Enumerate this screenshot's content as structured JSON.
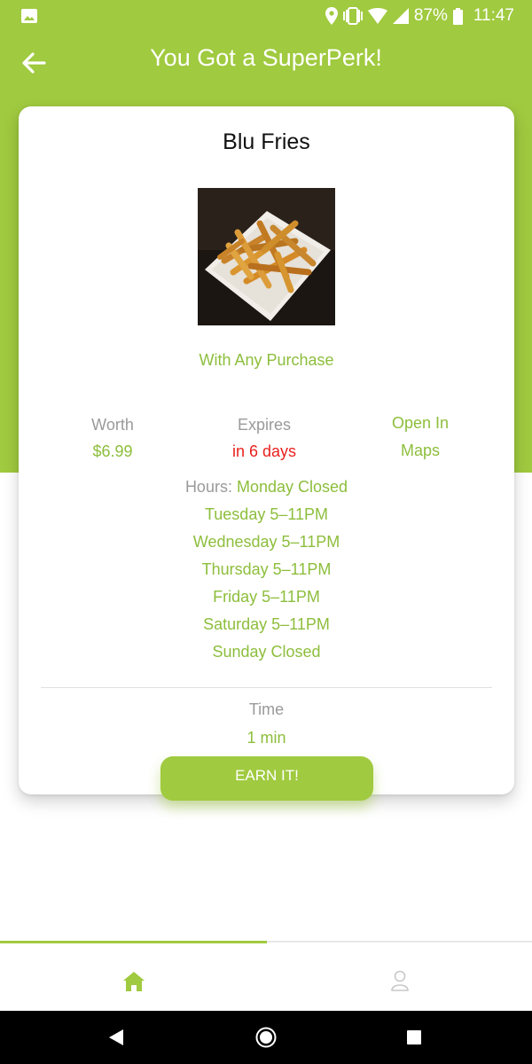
{
  "status_bar": {
    "battery": "87%",
    "time": "11:47",
    "icons": [
      "image-icon",
      "location-icon",
      "vibrate-icon",
      "wifi-icon",
      "signal-icon",
      "battery-icon"
    ]
  },
  "header": {
    "title": "You Got a SuperPerk!",
    "back_icon": "arrow-left-icon"
  },
  "perk": {
    "name": "Blu Fries",
    "image": "fries-photo",
    "condition": "With Any Purchase",
    "worth_label": "Worth",
    "worth_value": "$6.99",
    "expires_label": "Expires",
    "expires_value": "in 6 days",
    "maps_line1": "Open In",
    "maps_line2": "Maps",
    "hours_label": "Hours:",
    "hours": [
      "Monday Closed",
      "Tuesday 5–11PM",
      "Wednesday 5–11PM",
      "Thursday 5–11PM",
      "Friday 5–11PM",
      "Saturday 5–11PM",
      "Sunday Closed"
    ],
    "time_label": "Time",
    "time_value": "1 min",
    "earn_label": "EARN IT!"
  },
  "bottom_nav": {
    "items": [
      {
        "icon": "home-icon",
        "active": true
      },
      {
        "icon": "profile-icon",
        "active": false
      }
    ]
  },
  "colors": {
    "brand_green": "#a0ca3f",
    "text_green": "#8dbe3c",
    "expire_red": "#e8221e",
    "muted_gray": "#9a9a9a"
  }
}
